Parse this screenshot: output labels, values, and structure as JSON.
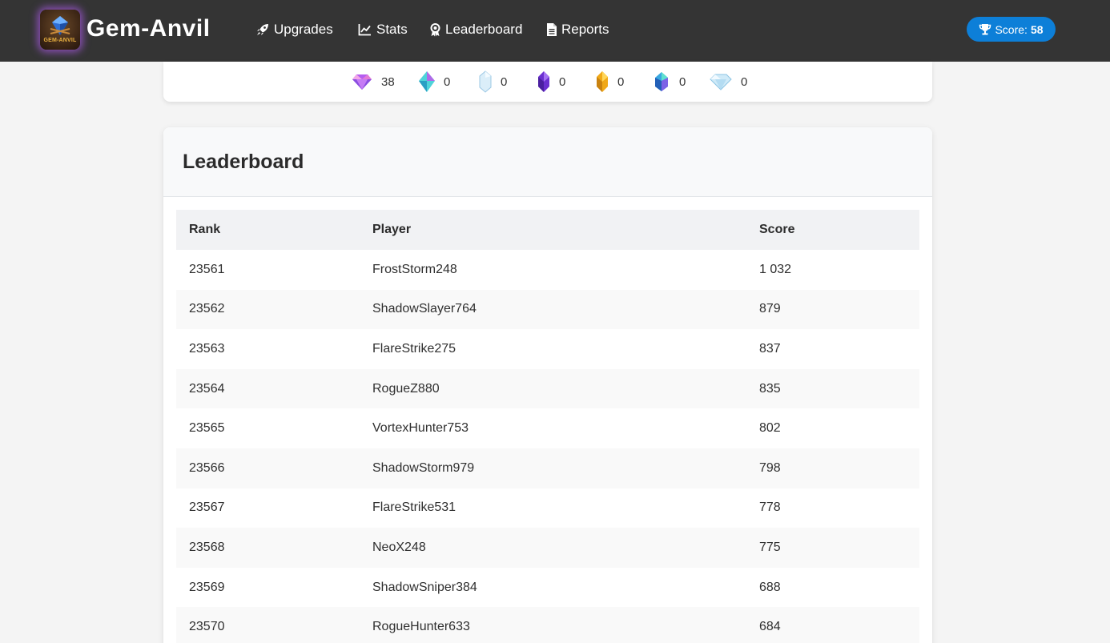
{
  "brand": {
    "name": "Gem-Anvil",
    "logo_text": "GEM-ANVIL"
  },
  "nav": {
    "items": [
      {
        "label": "Upgrades",
        "icon": "rocket-icon"
      },
      {
        "label": "Stats",
        "icon": "chart-line-icon"
      },
      {
        "label": "Leaderboard",
        "icon": "award-icon"
      },
      {
        "label": "Reports",
        "icon": "file-icon"
      }
    ]
  },
  "score": {
    "label": "Score:",
    "value": "58",
    "icon": "trophy-icon"
  },
  "gems": [
    {
      "name": "pink-diamond",
      "count": "38",
      "color": "#c65bf0"
    },
    {
      "name": "teal-crystal",
      "count": "0",
      "color": "#3fc9d6"
    },
    {
      "name": "clear-crystal",
      "count": "0",
      "color": "#cfe6f6"
    },
    {
      "name": "purple-crystal",
      "count": "0",
      "color": "#7b3fe4"
    },
    {
      "name": "gold-crystal",
      "count": "0",
      "color": "#f2b21c"
    },
    {
      "name": "blue-cluster",
      "count": "0",
      "color": "#3aa7e0"
    },
    {
      "name": "white-diamond",
      "count": "0",
      "color": "#cfeaf8"
    }
  ],
  "leaderboard": {
    "title": "Leaderboard",
    "columns": [
      "Rank",
      "Player",
      "Score"
    ],
    "rows": [
      {
        "rank": "23561",
        "player": "FrostStorm248",
        "score": "1 032"
      },
      {
        "rank": "23562",
        "player": "ShadowSlayer764",
        "score": "879"
      },
      {
        "rank": "23563",
        "player": "FlareStrike275",
        "score": "837"
      },
      {
        "rank": "23564",
        "player": "RogueZ880",
        "score": "835"
      },
      {
        "rank": "23565",
        "player": "VortexHunter753",
        "score": "802"
      },
      {
        "rank": "23566",
        "player": "ShadowStorm979",
        "score": "798"
      },
      {
        "rank": "23567",
        "player": "FlareStrike531",
        "score": "778"
      },
      {
        "rank": "23568",
        "player": "NeoX248",
        "score": "775"
      },
      {
        "rank": "23569",
        "player": "ShadowSniper384",
        "score": "688"
      },
      {
        "rank": "23570",
        "player": "RogueHunter633",
        "score": "684"
      }
    ]
  },
  "colors": {
    "navbar": "#343434",
    "accent": "#0d7fd8",
    "page_bg": "#f4f4f4"
  }
}
